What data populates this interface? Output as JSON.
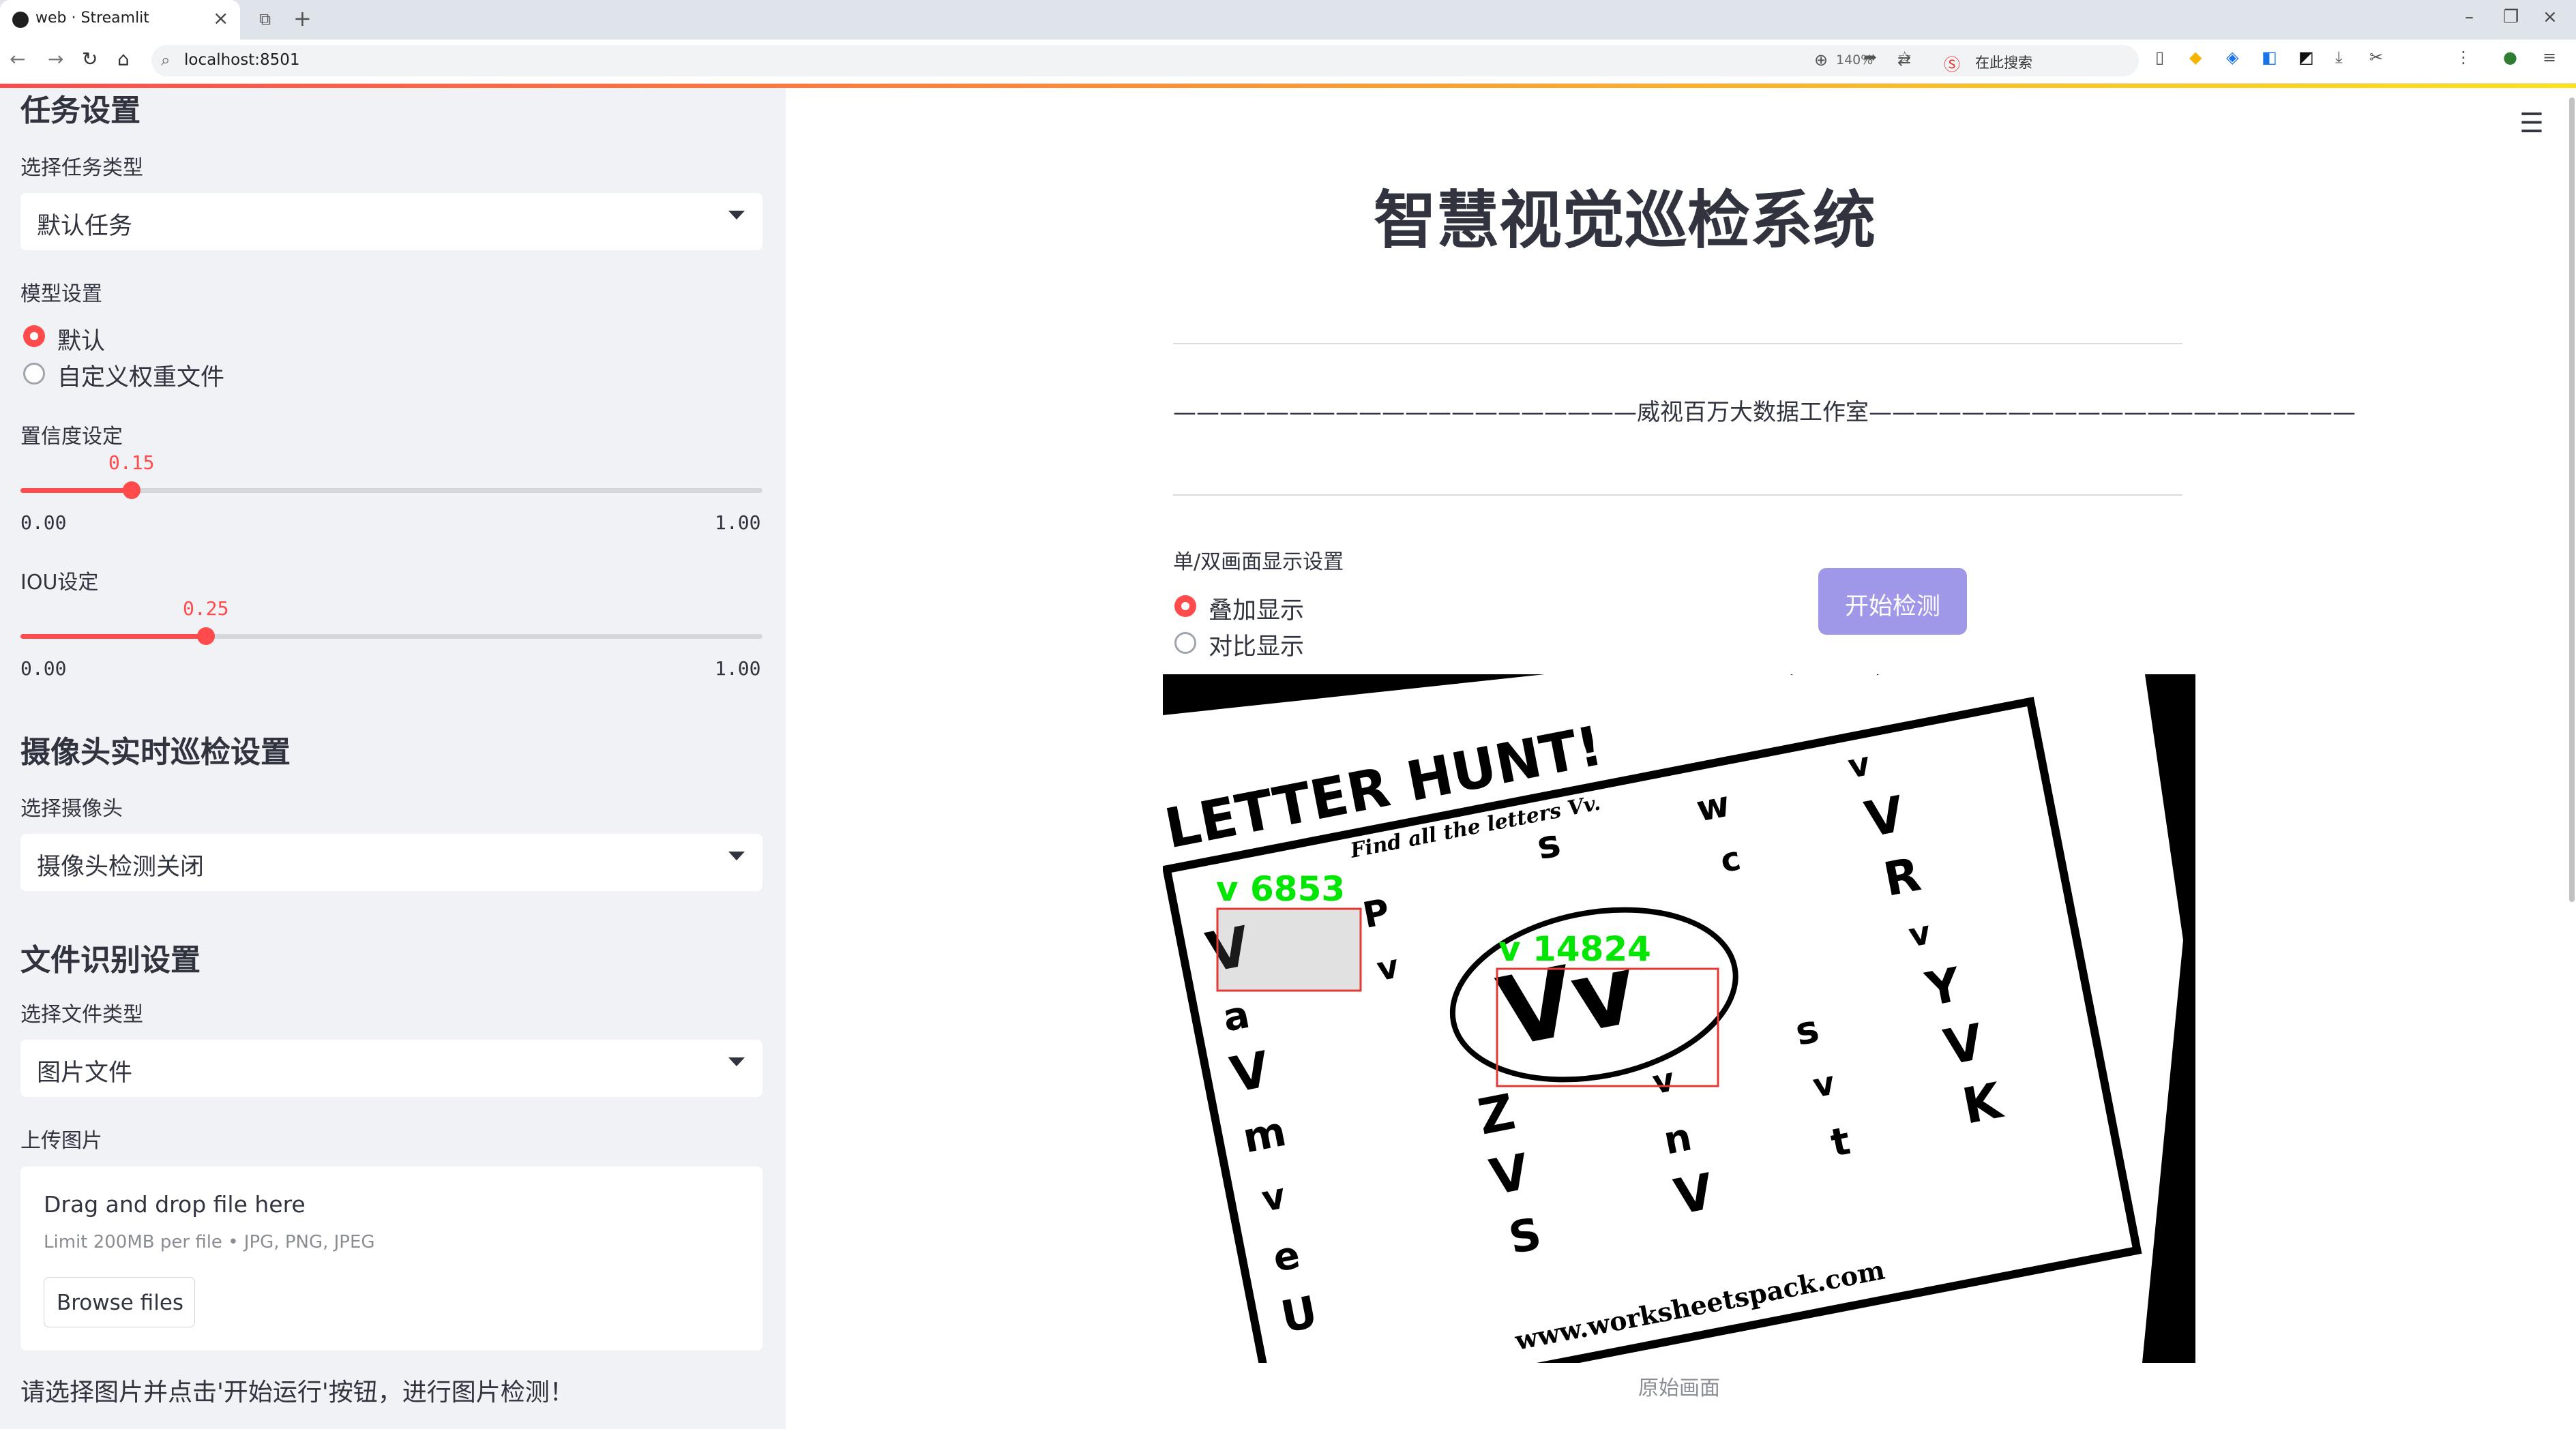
{
  "browser": {
    "tab_title": "web · Streamlit",
    "url": "localhost:8501",
    "zoom": "140%",
    "search_hint": "在此搜索"
  },
  "sidebar": {
    "task_heading": "任务设置",
    "task_type_label": "选择任务类型",
    "task_type_value": "默认任务",
    "model_label": "模型设置",
    "model_options": [
      {
        "label": "默认",
        "selected": true
      },
      {
        "label": "自定义权重文件",
        "selected": false
      }
    ],
    "confidence": {
      "label": "置信度设定",
      "value": "0.15",
      "fraction": 0.15,
      "min": "0.00",
      "max": "1.00"
    },
    "iou": {
      "label": "IOU设定",
      "value": "0.25",
      "fraction": 0.25,
      "min": "0.00",
      "max": "1.00"
    },
    "camera_heading": "摄像头实时巡检设置",
    "camera_label": "选择摄像头",
    "camera_value": "摄像头检测关闭",
    "file_heading": "文件识别设置",
    "file_type_label": "选择文件类型",
    "file_type_value": "图片文件",
    "upload_label": "上传图片",
    "dropzone": {
      "title": "Drag and drop file here",
      "limit": "Limit 200MB per file • JPG, PNG, JPEG",
      "browse_label": "Browse files"
    },
    "hint": "请选择图片并点击'开始运行'按钮，进行图片检测！"
  },
  "main": {
    "title": "智慧视觉巡检系统",
    "studio_line": "————————————————————威视百万大数据工作室—————————————————————",
    "display_label": "单/双画面显示设置",
    "display_options": [
      {
        "label": "叠加显示",
        "selected": true
      },
      {
        "label": "对比显示",
        "selected": false
      }
    ],
    "start_button": "开始检测",
    "caption": "原始画面",
    "worksheet": {
      "title": "LETTER HUNT!",
      "subtitle": "Find all the letters Vv.",
      "footer": "www.worksheetspack.com",
      "letters": {
        "col1": [
          "V",
          "a",
          "V",
          "m",
          "v",
          "e",
          "U"
        ],
        "col2": [
          "P",
          "v",
          "Z",
          "V",
          "S"
        ],
        "col3": [
          "s",
          "v",
          "n",
          "V"
        ],
        "col4": [
          "w",
          "c",
          "s",
          "v",
          "t"
        ],
        "col5": [
          "v",
          "V",
          "R",
          "v",
          "Y",
          "V",
          "K"
        ],
        "circled": "Vv"
      }
    },
    "detections": [
      {
        "label": "v 6853",
        "color": "#00e600"
      },
      {
        "label": "v 14824",
        "color": "#00e600"
      }
    ]
  }
}
